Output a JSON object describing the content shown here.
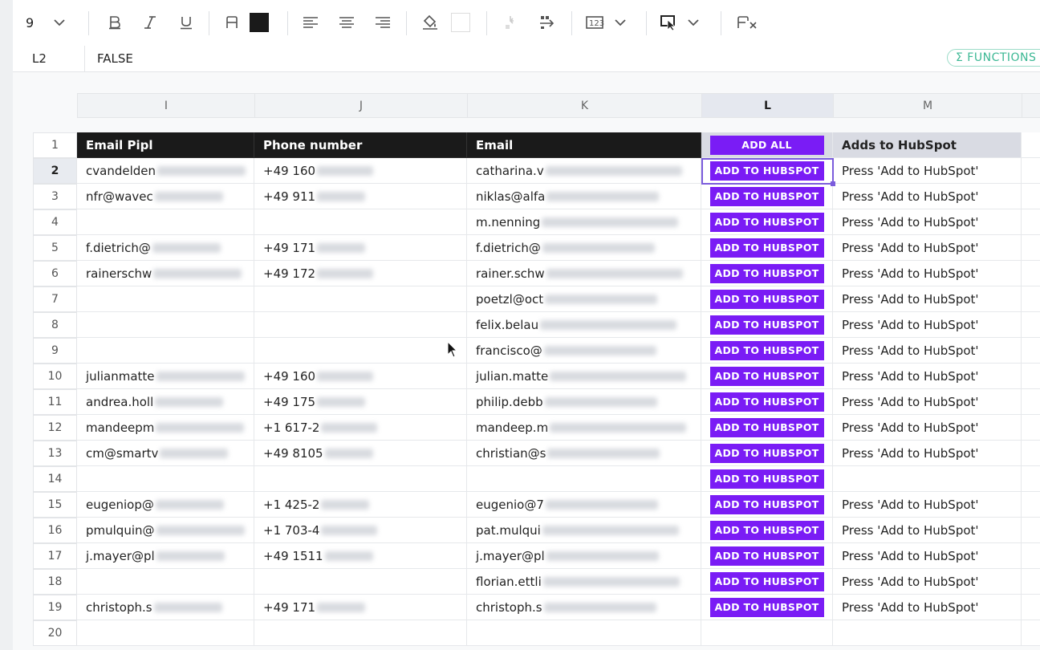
{
  "toolbar": {
    "font_size": "9",
    "buttons": [
      "font-size-dropdown",
      "bold",
      "italic",
      "underline",
      "text-color",
      "fill-color",
      "align-left",
      "align-center",
      "align-right",
      "fill-bucket",
      "background-color",
      "merge",
      "wrap",
      "number-format",
      "select-mode",
      "clear-format"
    ],
    "text_color_swatch": "#1a1a1a"
  },
  "formula_bar": {
    "cell_ref": "L2",
    "value": "FALSE",
    "functions_label": "Σ FUNCTIONS"
  },
  "columns": [
    "I",
    "J",
    "K",
    "L",
    "M"
  ],
  "selected_column": "L",
  "selected_row": "2",
  "rows": [
    {
      "n": "1",
      "i": "Email Pipl",
      "j": "Phone number",
      "k": "Email",
      "l": "ADD ALL",
      "m": "Adds to HubSpot"
    },
    {
      "n": "2",
      "i": "cvandelden",
      "j": "+49 160",
      "k": "catharina.v",
      "l": "ADD TO HUBSPOT",
      "m": "Press 'Add to HubSpot'"
    },
    {
      "n": "3",
      "i": "nfr@wavec",
      "j": "+49 911",
      "k": "niklas@alfa",
      "l": "ADD TO HUBSPOT",
      "m": "Press 'Add to HubSpot'"
    },
    {
      "n": "4",
      "i": "",
      "j": "",
      "k": "m.nenning",
      "l": "ADD TO HUBSPOT",
      "m": "Press 'Add to HubSpot'"
    },
    {
      "n": "5",
      "i": "f.dietrich@",
      "j": "+49 171",
      "k": "f.dietrich@",
      "l": "ADD TO HUBSPOT",
      "m": "Press 'Add to HubSpot'"
    },
    {
      "n": "6",
      "i": "rainerschw",
      "j": "+49 172",
      "k": "rainer.schw",
      "l": "ADD TO HUBSPOT",
      "m": "Press 'Add to HubSpot'"
    },
    {
      "n": "7",
      "i": "",
      "j": "",
      "k": "poetzl@oct",
      "l": "ADD TO HUBSPOT",
      "m": "Press 'Add to HubSpot'"
    },
    {
      "n": "8",
      "i": "",
      "j": "",
      "k": "felix.belau",
      "l": "ADD TO HUBSPOT",
      "m": "Press 'Add to HubSpot'"
    },
    {
      "n": "9",
      "i": "",
      "j": "",
      "k": "francisco@",
      "l": "ADD TO HUBSPOT",
      "m": "Press 'Add to HubSpot'"
    },
    {
      "n": "10",
      "i": "julianmatte",
      "j": "+49 160",
      "k": "julian.matte",
      "l": "ADD TO HUBSPOT",
      "m": "Press 'Add to HubSpot'"
    },
    {
      "n": "11",
      "i": "andrea.holl",
      "j": "+49 175",
      "k": "philip.debb",
      "l": "ADD TO HUBSPOT",
      "m": "Press 'Add to HubSpot'"
    },
    {
      "n": "12",
      "i": "mandeepm",
      "j": "+1 617-2",
      "k": "mandeep.m",
      "l": "ADD TO HUBSPOT",
      "m": "Press 'Add to HubSpot'"
    },
    {
      "n": "13",
      "i": "cm@smartv",
      "j": "+49 8105",
      "k": "christian@s",
      "l": "ADD TO HUBSPOT",
      "m": "Press 'Add to HubSpot'"
    },
    {
      "n": "14",
      "i": "",
      "j": "",
      "k": "",
      "l": "ADD TO HUBSPOT",
      "m": ""
    },
    {
      "n": "15",
      "i": "eugeniop@",
      "j": "+1 425-2",
      "k": "eugenio@7",
      "l": "ADD TO HUBSPOT",
      "m": "Press 'Add to HubSpot'"
    },
    {
      "n": "16",
      "i": "pmulquin@",
      "j": "+1 703-4",
      "k": "pat.mulqui",
      "l": "ADD TO HUBSPOT",
      "m": "Press 'Add to HubSpot'"
    },
    {
      "n": "17",
      "i": "j.mayer@pl",
      "j": "+49 1511",
      "k": "j.mayer@pl",
      "l": "ADD TO HUBSPOT",
      "m": "Press 'Add to HubSpot'"
    },
    {
      "n": "18",
      "i": "",
      "j": "",
      "k": "florian.ettli",
      "l": "ADD TO HUBSPOT",
      "m": "Press 'Add to HubSpot'"
    },
    {
      "n": "19",
      "i": "christoph.s",
      "j": "+49 171",
      "k": "christoph.s",
      "l": "ADD TO HUBSPOT",
      "m": "Press 'Add to HubSpot'"
    },
    {
      "n": "20",
      "i": "",
      "j": "",
      "k": "",
      "l": "",
      "m": ""
    }
  ],
  "colors": {
    "accent": "#7a1cf5",
    "header_dark": "#1a1a1a",
    "selection": "#7b5cdc",
    "functions": "#3cb894"
  }
}
